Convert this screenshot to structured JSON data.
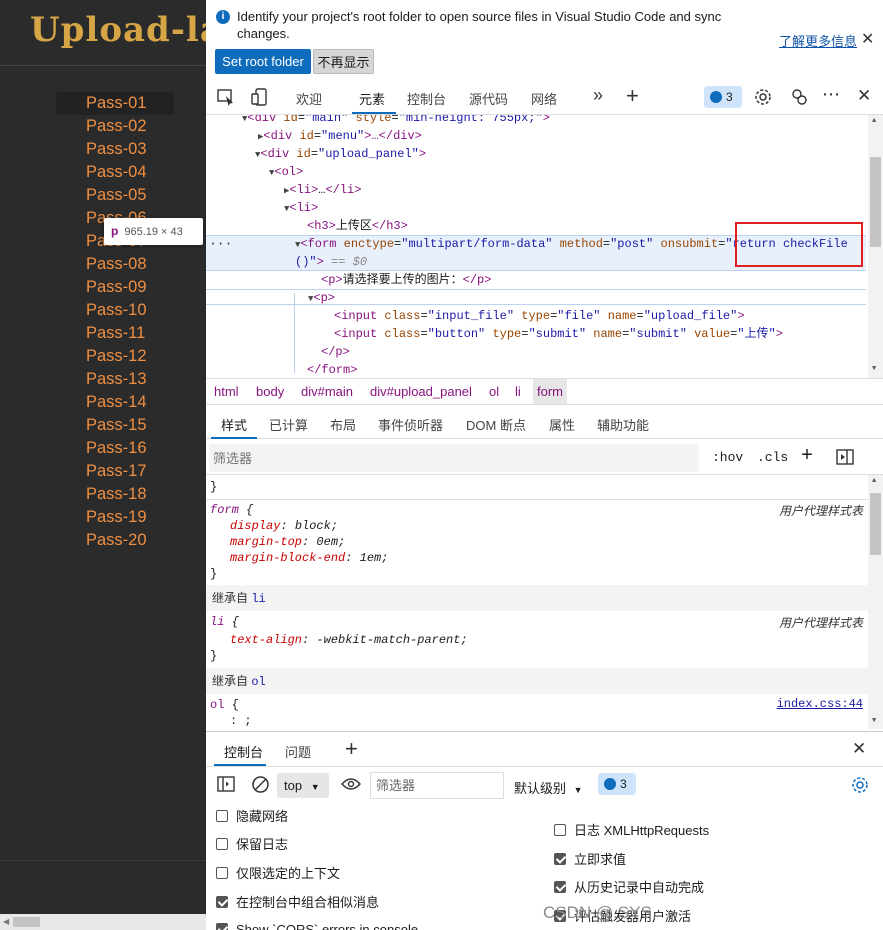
{
  "page": {
    "logo_text": "Upload-labs",
    "pass_items": [
      "Pass-01",
      "Pass-02",
      "Pass-03",
      "Pass-04",
      "Pass-05",
      "Pass-06",
      "Pass-07",
      "Pass-08",
      "Pass-09",
      "Pass-10",
      "Pass-11",
      "Pass-12",
      "Pass-13",
      "Pass-14",
      "Pass-15",
      "Pass-16",
      "Pass-17",
      "Pass-18",
      "Pass-19",
      "Pass-20"
    ],
    "tooltip": {
      "tag": "p",
      "dims": "965.19 × 43"
    }
  },
  "banner": {
    "message": "Identify your project's root folder to open source files in Visual Studio Code and sync changes.",
    "learn_more": "了解更多信息",
    "set_root": "Set root folder",
    "dont_show": "不再显示"
  },
  "tabs": {
    "welcome": "欢迎",
    "elements": "元素",
    "console": "控制台",
    "sources": "源代码",
    "network": "网络",
    "issues_count": "3"
  },
  "dom": {
    "l1_tag": "<div",
    "l1_attr1": "id",
    "l1_val1": "\"main\"",
    "l1_attr2": "style",
    "l1_val2": "\"min-height: 755px;\"",
    "l1_end": ">",
    "l2_open": "<div",
    "l2_attr": "id",
    "l2_val": "\"menu\"",
    "l2_rest": ">…</div>",
    "l3_open": "<div",
    "l3_attr": "id",
    "l3_val": "\"upload_panel\"",
    "l3_end": ">",
    "l4": "<ol>",
    "l5_open": "<li>",
    "l5_mid": "…",
    "l5_close": "</li>",
    "l6": "<li>",
    "l7_open": "<h3>",
    "l7_text": "上传区",
    "l7_close": "</h3>",
    "l8_open": "<form",
    "l8_a1": "enctype",
    "l8_v1": "\"multipart/form-data\"",
    "l8_a2": "method",
    "l8_v2": "\"post\"",
    "l8_a3": "onsubmit",
    "l8_v3a": "\"return checkFile",
    "l8_v3b": "()\"",
    "l8_end": ">",
    "l8_eq": "== $0",
    "l9_open": "<p>",
    "l9_text": "请选择要上传的图片：",
    "l9_close": "</p>",
    "l10": "<p>",
    "l11_open": "<input",
    "l11_a1": "class",
    "l11_v1": "\"input_file\"",
    "l11_a2": "type",
    "l11_v2": "\"file\"",
    "l11_a3": "name",
    "l11_v3": "\"upload_file\"",
    "l11_end": ">",
    "l12_open": "<input",
    "l12_a1": "class",
    "l12_v1": "\"button\"",
    "l12_a2": "type",
    "l12_v2": "\"submit\"",
    "l12_a3": "name",
    "l12_v3": "\"submit\"",
    "l12_a4": "value",
    "l12_v4": "\"上传\"",
    "l12_end": ">",
    "l13": "</p>",
    "l14": "</form>"
  },
  "breadcrumbs": [
    "html",
    "body",
    "div#main",
    "div#upload_panel",
    "ol",
    "li",
    "form"
  ],
  "subtabs": [
    "样式",
    "已计算",
    "布局",
    "事件侦听器",
    "DOM 断点",
    "属性",
    "辅助功能"
  ],
  "styles_filter": {
    "placeholder": "筛选器",
    "hov": ":hov",
    "cls": ".cls"
  },
  "styles": {
    "brace_close": "}",
    "rule1_selector": "form",
    "rule1_source": "用户代理样式表",
    "rule1_props": [
      {
        "name": "display",
        "value": "block;"
      },
      {
        "name": "margin-top",
        "value": "0em;"
      },
      {
        "name": "margin-block-end",
        "value": "1em;"
      }
    ],
    "inherit1_label": "继承自",
    "inherit1_tag": "li",
    "rule2_selector": "li",
    "rule2_source": "用户代理样式表",
    "rule2_prop": {
      "name": "text-align",
      "value": "-webkit-match-parent;"
    },
    "inherit2_label": "继承自",
    "inherit2_tag": "ol",
    "rule3_selector": "ol",
    "rule3_source": "index.css:44",
    "rule3_partial": ": ;"
  },
  "drawer": {
    "tab_console": "控制台",
    "tab_issues": "问题",
    "context": "top",
    "filter_placeholder": "筛选器",
    "level": "默认级别",
    "badge_count": "3"
  },
  "console_settings": {
    "left": [
      {
        "label": "隐藏网络",
        "checked": false
      },
      {
        "label": "保留日志",
        "checked": false
      },
      {
        "label": "仅限选定的上下文",
        "checked": false
      },
      {
        "label": "在控制台中组合相似消息",
        "checked": true
      },
      {
        "label": "Show `CORS` errors in console",
        "checked": true
      }
    ],
    "right": [
      {
        "label": "日志 XMLHttpRequests",
        "checked": false
      },
      {
        "label": "立即求值",
        "checked": true
      },
      {
        "label": "从历史记录中自动完成",
        "checked": true
      },
      {
        "label": "评估触发器用户激活",
        "checked": true
      }
    ]
  },
  "watermark": "CSDN @.SYS.",
  "colors": {
    "accent": "#0f6cbd",
    "pass_link": "#ee8f43",
    "logo": "#d6a646",
    "highlight_box": "#e02020"
  }
}
